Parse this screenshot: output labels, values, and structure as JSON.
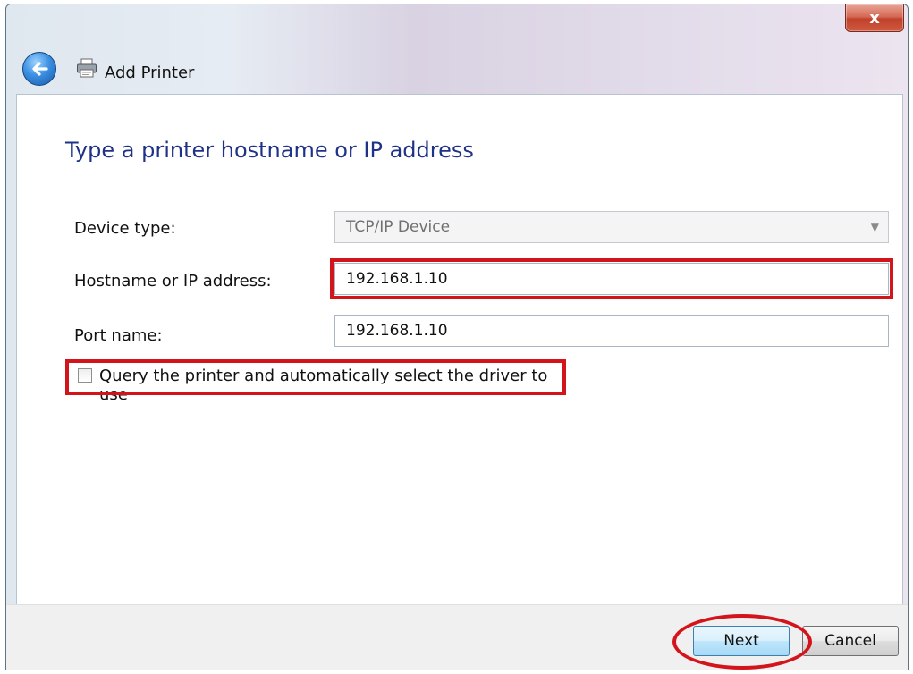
{
  "window": {
    "title": "Add Printer",
    "close_glyph": "x",
    "back_icon": "back-arrow-icon",
    "printer_icon": "printer-icon"
  },
  "heading": "Type a printer hostname or IP address",
  "fields": {
    "device_type_label": "Device type:",
    "device_type_value": "TCP/IP Device",
    "hostname_label": "Hostname or IP address:",
    "hostname_value": "192.168.1.10",
    "port_label": "Port name:",
    "port_value": "192.168.1.10"
  },
  "query_checkbox": {
    "label": "Query the printer and automatically select the driver to use",
    "checked": false
  },
  "buttons": {
    "next": "Next",
    "cancel": "Cancel"
  },
  "colors": {
    "heading": "#1e3287",
    "highlight": "#d4141b"
  }
}
